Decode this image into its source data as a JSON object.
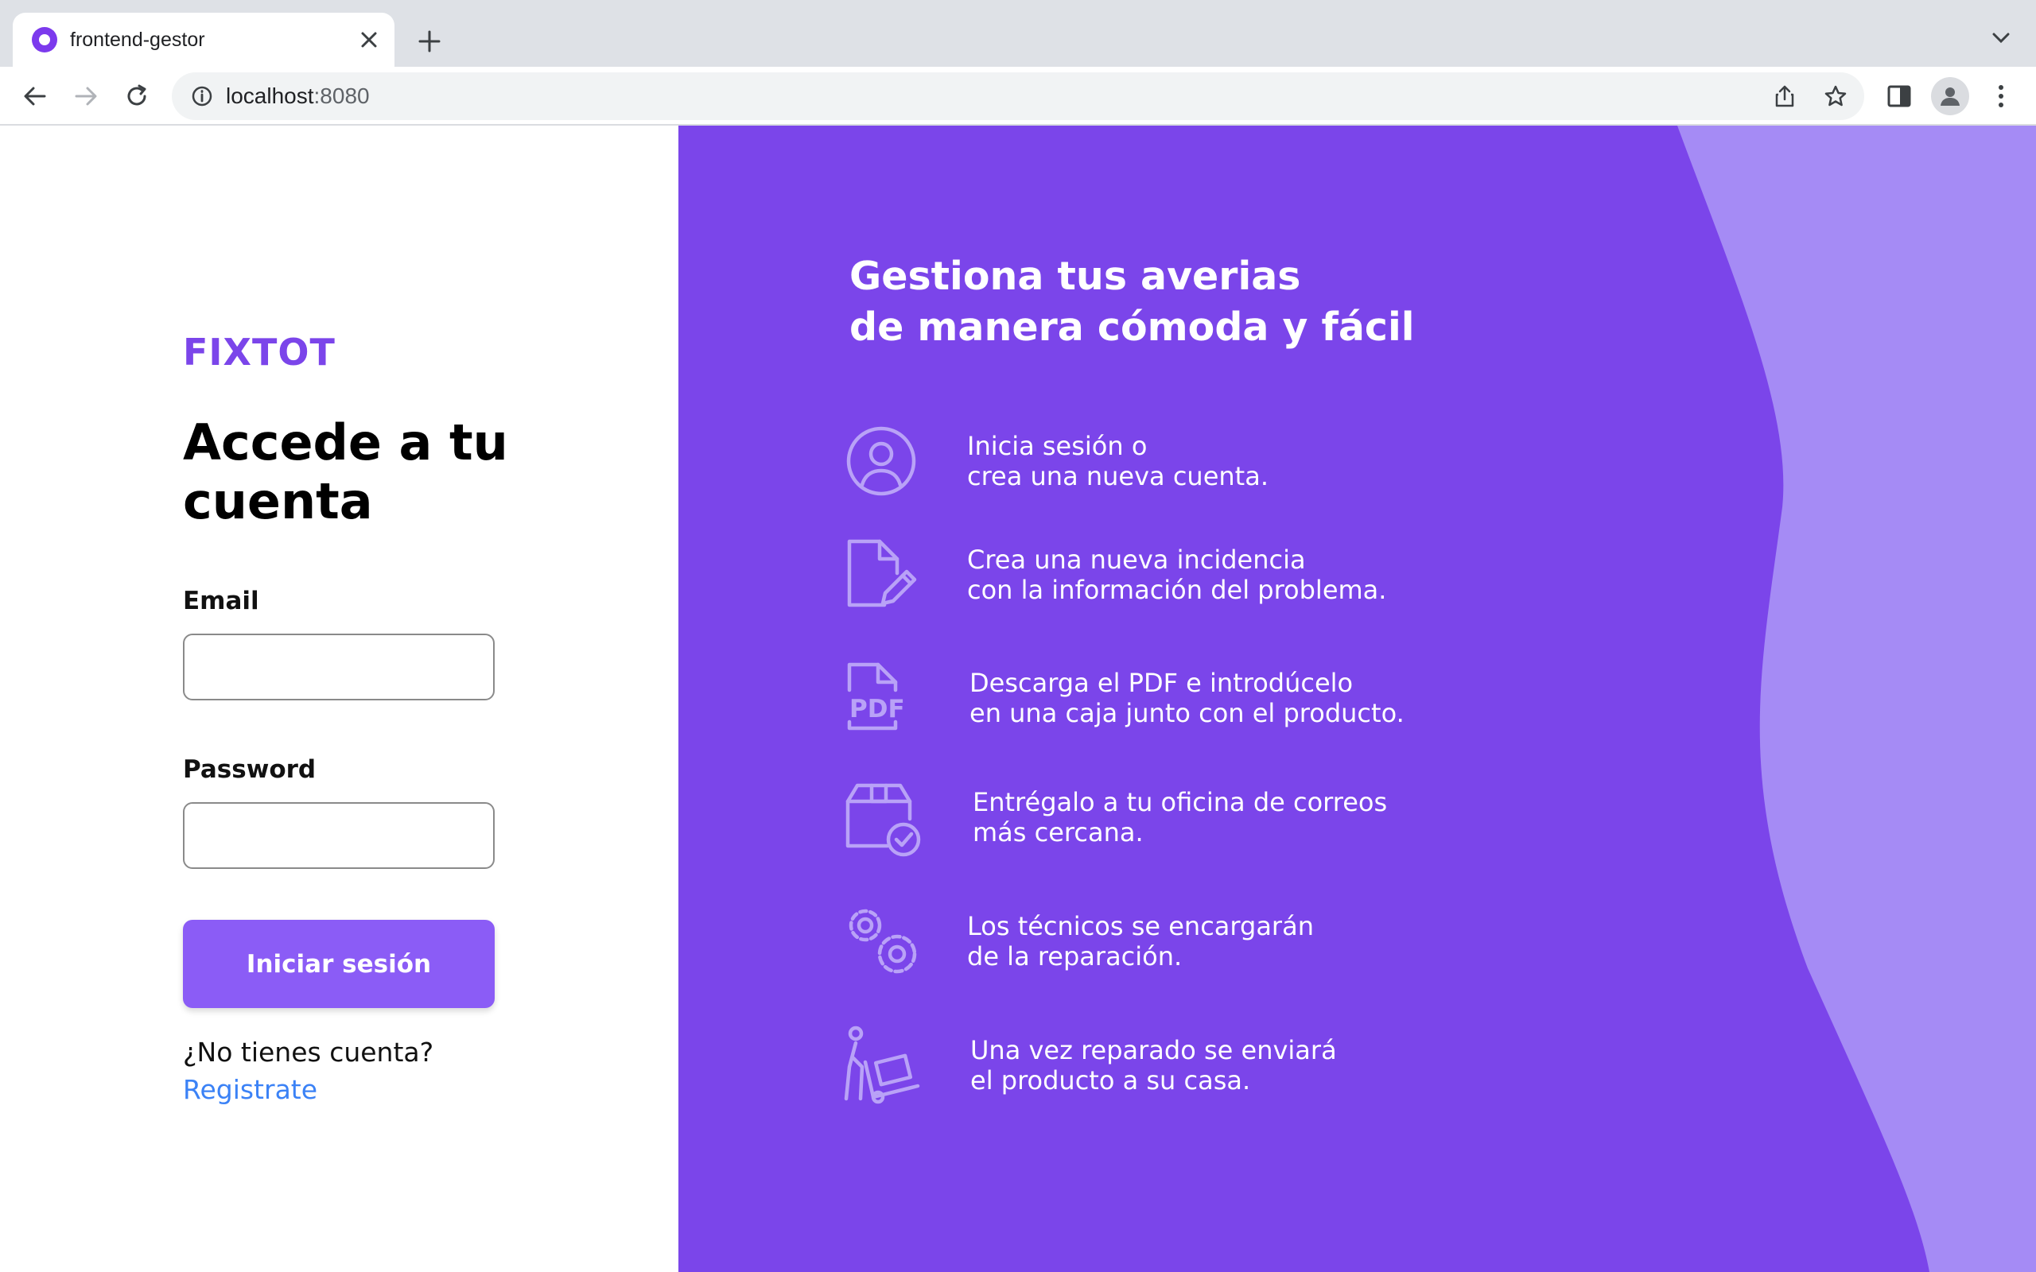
{
  "browser": {
    "tab_title": "frontend-gestor",
    "url_host": "localhost",
    "url_port": ":8080",
    "icons": [
      "favicon",
      "close-icon",
      "plus-icon",
      "chevron-down-icon",
      "back-arrow-icon",
      "forward-arrow-icon",
      "reload-icon",
      "info-icon",
      "share-icon",
      "star-icon",
      "side-panel-icon",
      "profile-icon",
      "kebab-menu-icon"
    ]
  },
  "login": {
    "brand": "FIXTOT",
    "title_line1": "Accede a tu",
    "title_line2": "cuenta",
    "email_label": "Email",
    "email_value": "",
    "password_label": "Password",
    "password_value": "",
    "submit_label": "Iniciar sesión",
    "no_account_text": "¿No tienes cuenta?",
    "register_link": "Registrate"
  },
  "promo": {
    "headline_line1": "Gestiona tus averias",
    "headline_line2": "de manera cómoda y fácil",
    "steps": [
      {
        "icon": "user-circle-icon",
        "line1": "Inicia sesión o",
        "line2": "crea una nueva cuenta."
      },
      {
        "icon": "document-edit-icon",
        "line1": "Crea una nueva incidencia",
        "line2": "con la información del problema."
      },
      {
        "icon": "pdf-file-icon",
        "line1": "Descarga el PDF e introdúcelo",
        "line2": "en una caja junto con el producto."
      },
      {
        "icon": "package-check-icon",
        "line1": "Entrégalo a tu oficina de correos",
        "line2": "más cercana."
      },
      {
        "icon": "gears-icon",
        "line1": "Los técnicos se encargarán",
        "line2": "de la reparación."
      },
      {
        "icon": "delivery-dolly-icon",
        "line1": "Una vez reparado se enviará",
        "line2": "el producto a su casa."
      }
    ]
  },
  "colors": {
    "brand_purple": "#7b45ea",
    "button_purple": "#8b5cf6",
    "wave_light": "#a58bf5",
    "link_blue": "#3b82f6"
  }
}
